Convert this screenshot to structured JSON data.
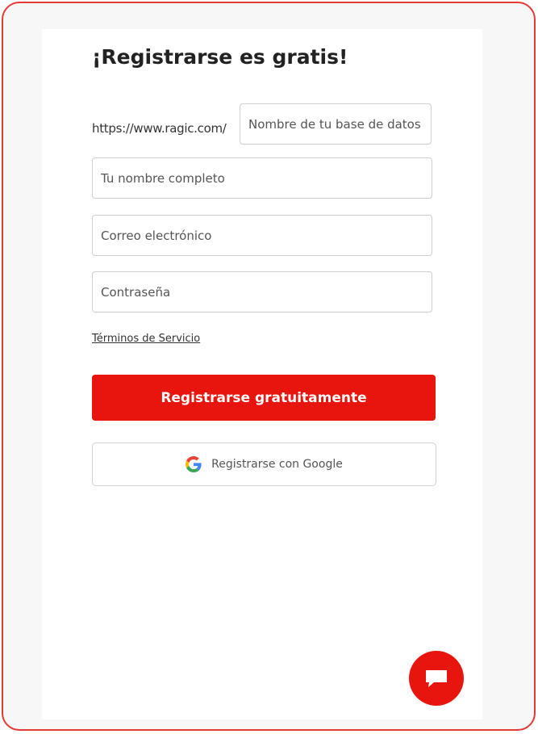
{
  "form": {
    "title": "¡Registrarse es gratis!",
    "url_prefix": "https://www.ragic.com/",
    "database_name": {
      "placeholder": "Nombre de tu base de datos",
      "value": ""
    },
    "full_name": {
      "placeholder": "Tu nombre completo",
      "value": ""
    },
    "email": {
      "placeholder": "Correo electrónico",
      "value": ""
    },
    "password": {
      "placeholder": "Contraseña",
      "value": ""
    },
    "terms_link": "Términos de Servicio",
    "signup_button": "Registrarse gratuitamente",
    "google_button": "Registrarse con Google"
  },
  "icons": {
    "google": "google-icon",
    "chat": "chat-bubble-icon"
  },
  "colors": {
    "accent": "#e8150f",
    "frame_border": "#e53935",
    "page_background": "#f7f7f7"
  }
}
